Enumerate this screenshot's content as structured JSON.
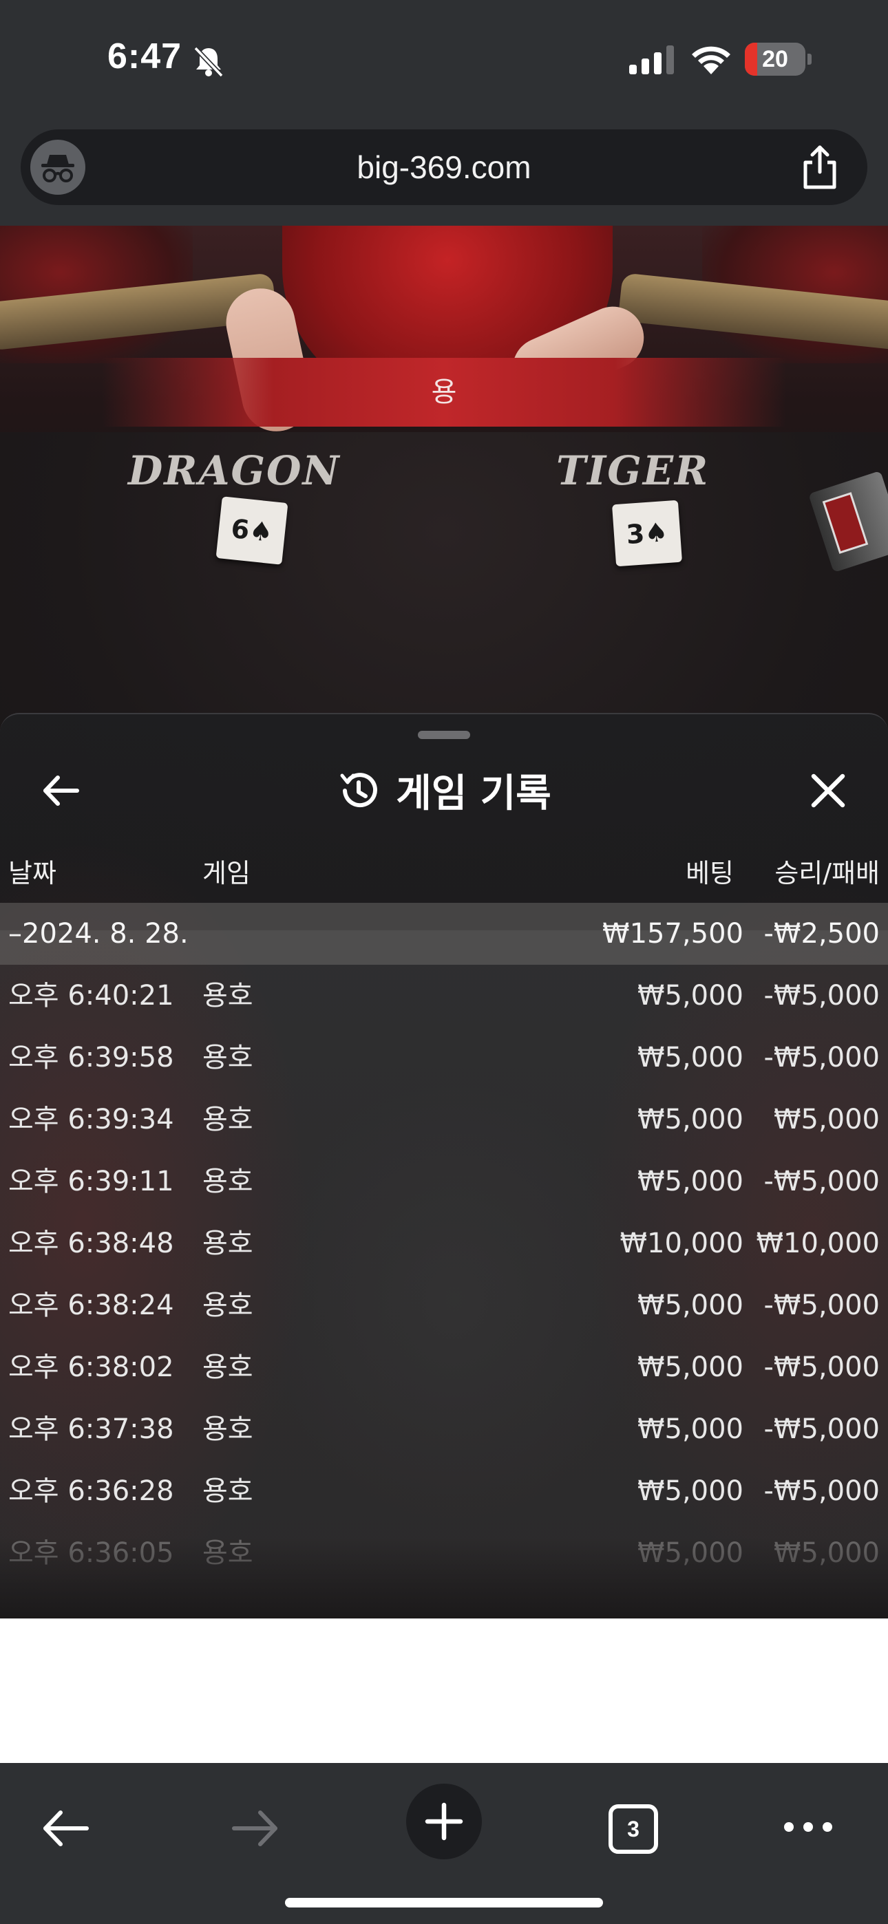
{
  "status_bar": {
    "time": "6:47",
    "battery": "20",
    "battery_level": 0.2,
    "battery_color": "#e5332a"
  },
  "browser": {
    "url": "big-369.com",
    "incognito_icon": "incognito-icon",
    "share_icon": "share-icon"
  },
  "video": {
    "result_text": "용",
    "dragon_label": "DRAGON",
    "tiger_label": "TIGER",
    "dragon_card": "6♠",
    "tiger_card": "3♠"
  },
  "history_panel": {
    "title": "게임 기록",
    "title_icon": "history-icon",
    "columns": {
      "date": "날짜",
      "game": "게임",
      "bet": "베팅",
      "result": "승리/패배"
    },
    "summary": {
      "date": "–2024. 8. 28.",
      "bet": "₩157,500",
      "result": "-₩2,500"
    },
    "rows": [
      {
        "time": "오후 6:40:21",
        "game": "용호",
        "bet": "₩5,000",
        "result": "-₩5,000"
      },
      {
        "time": "오후 6:39:58",
        "game": "용호",
        "bet": "₩5,000",
        "result": "-₩5,000"
      },
      {
        "time": "오후 6:39:34",
        "game": "용호",
        "bet": "₩5,000",
        "result": "₩5,000"
      },
      {
        "time": "오후 6:39:11",
        "game": "용호",
        "bet": "₩5,000",
        "result": "-₩5,000"
      },
      {
        "time": "오후 6:38:48",
        "game": "용호",
        "bet": "₩10,000",
        "result": "₩10,000"
      },
      {
        "time": "오후 6:38:24",
        "game": "용호",
        "bet": "₩5,000",
        "result": "-₩5,000"
      },
      {
        "time": "오후 6:38:02",
        "game": "용호",
        "bet": "₩5,000",
        "result": "-₩5,000"
      },
      {
        "time": "오후 6:37:38",
        "game": "용호",
        "bet": "₩5,000",
        "result": "-₩5,000"
      },
      {
        "time": "오후 6:36:28",
        "game": "용호",
        "bet": "₩5,000",
        "result": "-₩5,000"
      },
      {
        "time": "오후 6:36:05",
        "game": "용호",
        "bet": "₩5,000",
        "result": "₩5,000"
      }
    ]
  },
  "toolbar": {
    "tab_count": "3"
  }
}
